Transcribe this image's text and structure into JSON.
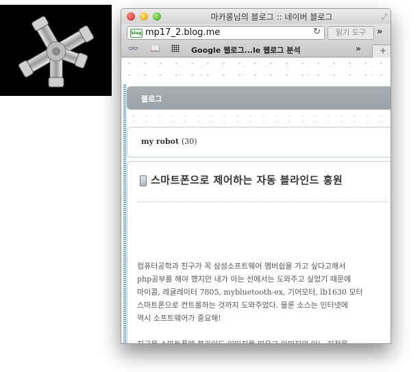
{
  "window": {
    "title": "마카롱님의 블로그 :: 네이버 블로그",
    "url": "mp17_2.blog.me",
    "favicon_label": "blog",
    "reader_label": "읽기 도구"
  },
  "bookmarks": {
    "items_label": "Google 웹로그...le 웹로그 분석"
  },
  "blog": {
    "nav_label": "블로그",
    "category": "my robot",
    "category_count": "(30)",
    "post_title": "스마트폰으로 제어하는 자동 블라인드 홍원",
    "body_lines": [
      "컴퓨터공학과 친구가 꼭 삼성소프트웨어 멤버쉽을 가고 싶다고해서",
      "php공부를 해야 했지만 내가 아는 선에서는 도와주고 싶었기 때문에",
      "마이콤, 레귤레이터 7805, mybluetooth-ex, 기어모터, lb1630 모터",
      "스마트폰으로 컨트롤하는 것까지 도와주었다. 물론 소스는 인터넷에",
      "역시 소프트웨어가 중요해!",
      "",
      "지금은 스마트폰에 블라인드 이미지를 띄우고 이미지의  어느 지점을"
    ]
  },
  "icons": {
    "reload": "reload-icon",
    "more": "chevron-double-right-icon",
    "new_tab": "plus-icon",
    "resize": "fullscreen-icon"
  }
}
